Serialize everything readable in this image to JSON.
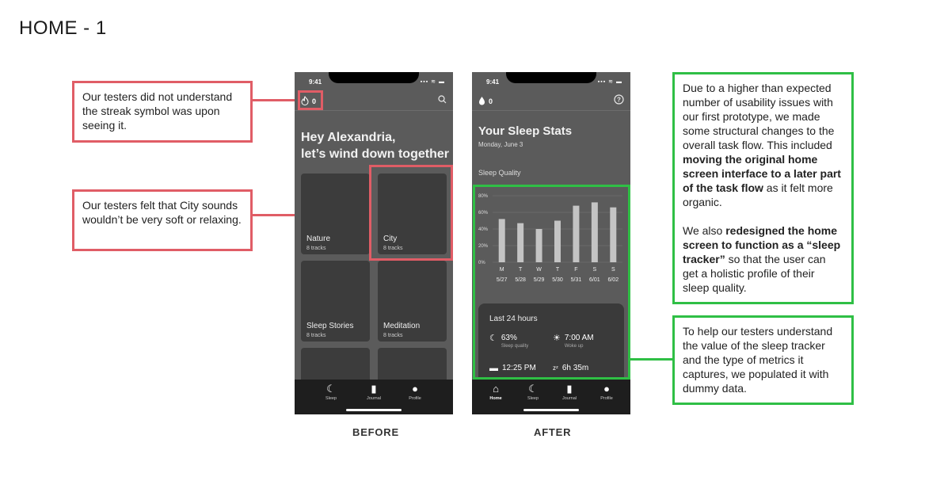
{
  "page_title": "HOME - 1",
  "captions": {
    "before": "BEFORE",
    "after": "AFTER"
  },
  "notes": {
    "streak": "Our testers did not understand the streak symbol was upon seeing it.",
    "city": "Our testers felt that City sounds wouldn’t be very soft or relaxing.",
    "redesign_p1_a": "Due to a higher than expected number of usability issues with our first prototype, we made some structural changes to the overall task flow. This included ",
    "redesign_p1_b": "moving the original home screen interface to a later part of the task flow",
    "redesign_p1_c": " as it felt more organic.",
    "redesign_p2_a": "We also ",
    "redesign_p2_b": "redesigned the home screen to function as a “sleep tracker”",
    "redesign_p2_c": " so that the user can get a holistic profile of their sleep quality.",
    "tracker": "To help our testers understand the value of the sleep tracker and the type of metrics it captures, we populated it with dummy data."
  },
  "before_phone": {
    "time": "9:41",
    "streak_count": "0",
    "greeting_line1": "Hey Alexandria,",
    "greeting_line2": "let’s wind down together",
    "cards": [
      {
        "name": "Nature",
        "sub": "8 tracks"
      },
      {
        "name": "City",
        "sub": "8 tracks"
      },
      {
        "name": "Sleep Stories",
        "sub": "8 tracks"
      },
      {
        "name": "Meditation",
        "sub": "8 tracks"
      }
    ],
    "tabs": [
      "Sleep",
      "Journal",
      "Profile"
    ]
  },
  "after_phone": {
    "time": "9:41",
    "streak_count": "0",
    "title": "Your Sleep Stats",
    "date": "Monday, June 3",
    "section": "Sleep Quality",
    "last24": {
      "title": "Last 24 hours",
      "metrics": [
        {
          "value": "63%",
          "label": "Sleep quality",
          "icon": "moon-icon"
        },
        {
          "value": "7:00 AM",
          "label": "Woke up",
          "icon": "sun-icon"
        },
        {
          "value": "12:25 PM",
          "label": "",
          "icon": "bed-icon"
        },
        {
          "value": "6h 35m",
          "label": "",
          "icon": "zzz-icon"
        }
      ]
    },
    "tabs": [
      "Home",
      "Sleep",
      "Journal",
      "Profile"
    ]
  },
  "chart_data": {
    "type": "bar",
    "categories": [
      "M",
      "T",
      "W",
      "T",
      "F",
      "S",
      "S"
    ],
    "dates": [
      "5/27",
      "5/28",
      "5/29",
      "5/30",
      "5/31",
      "6/01",
      "6/02"
    ],
    "values": [
      52,
      47,
      40,
      50,
      68,
      72,
      66
    ],
    "yticks": [
      "0%",
      "20%",
      "40%",
      "60%",
      "80%"
    ],
    "ylim": [
      0,
      80
    ],
    "grid": true,
    "bar_color": "#c4c4c4"
  },
  "colors": {
    "red": "#e05d66",
    "green": "#2fbf45",
    "phone_bg": "#5b5b5b",
    "tabbar": "#1e1e1e"
  }
}
